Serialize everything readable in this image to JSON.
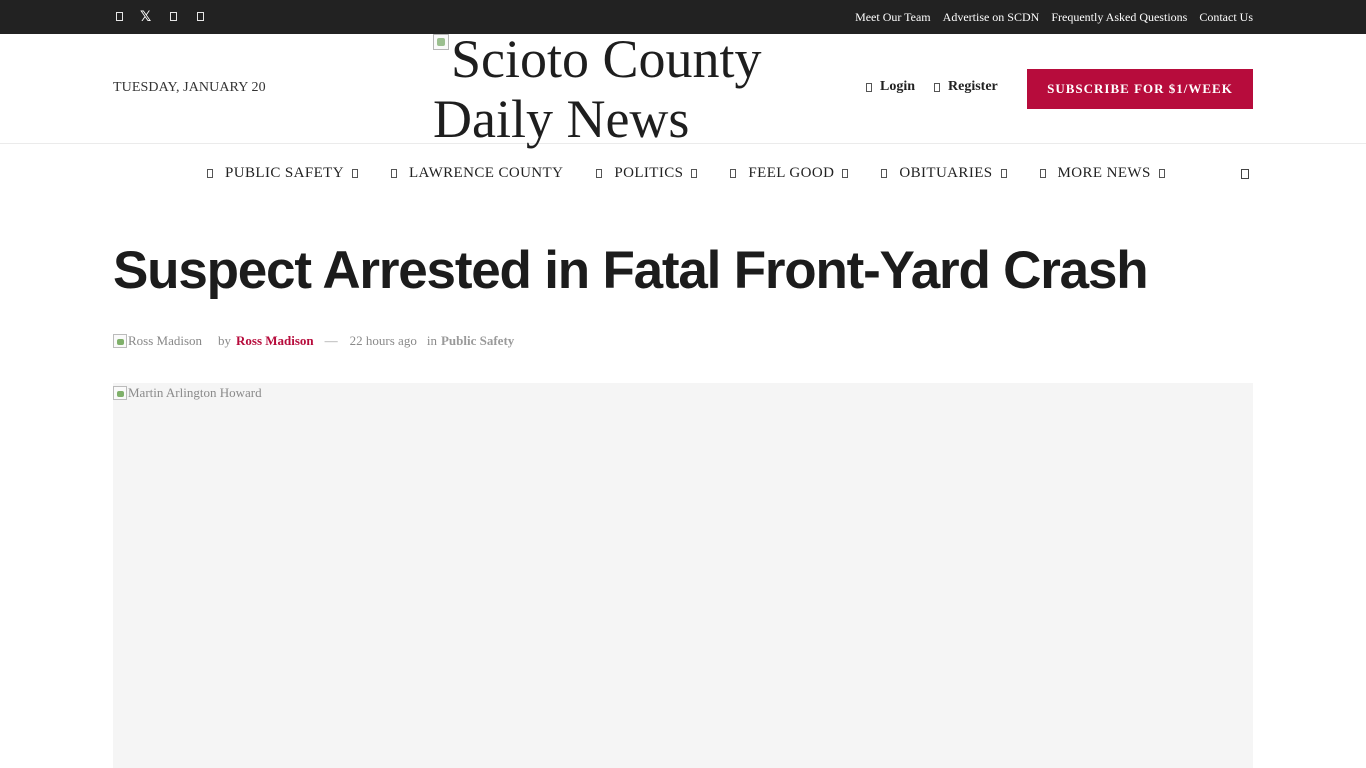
{
  "topbar": {
    "social": [
      {
        "icon": "facebook-icon"
      },
      {
        "icon": "x-twitter-icon",
        "glyph": "𝕏"
      },
      {
        "icon": "instagram-icon"
      },
      {
        "icon": "youtube-icon"
      }
    ],
    "links": [
      "Meet Our Team",
      "Advertise on SCDN",
      "Frequently Asked Questions",
      "Contact Us"
    ]
  },
  "header": {
    "date": "TUESDAY, JANUARY 20",
    "logo_alt_line1": "Scioto County",
    "logo_alt_line2": "Daily News",
    "login": "Login",
    "register": "Register",
    "subscribe": "SUBSCRIBE FOR $1/WEEK"
  },
  "nav": {
    "items": [
      {
        "label": "PUBLIC SAFETY"
      },
      {
        "label": "LAWRENCE COUNTY"
      },
      {
        "label": "POLITICS"
      },
      {
        "label": "FEEL GOOD"
      },
      {
        "label": "OBITUARIES"
      },
      {
        "label": "MORE NEWS"
      }
    ]
  },
  "article": {
    "title": "Suspect Arrested in Fatal Front-Yard Crash",
    "avatar_alt": "Ross Madison",
    "by": "by",
    "author": "Ross Madison",
    "separator": "—",
    "time": "22 hours ago",
    "in": "in",
    "category": "Public Safety",
    "featured_alt": "Martin Arlington Howard"
  },
  "colors": {
    "topbar_bg": "#222222",
    "accent": "#b70c3c",
    "image_placeholder_bg": "#f5f5f5"
  }
}
